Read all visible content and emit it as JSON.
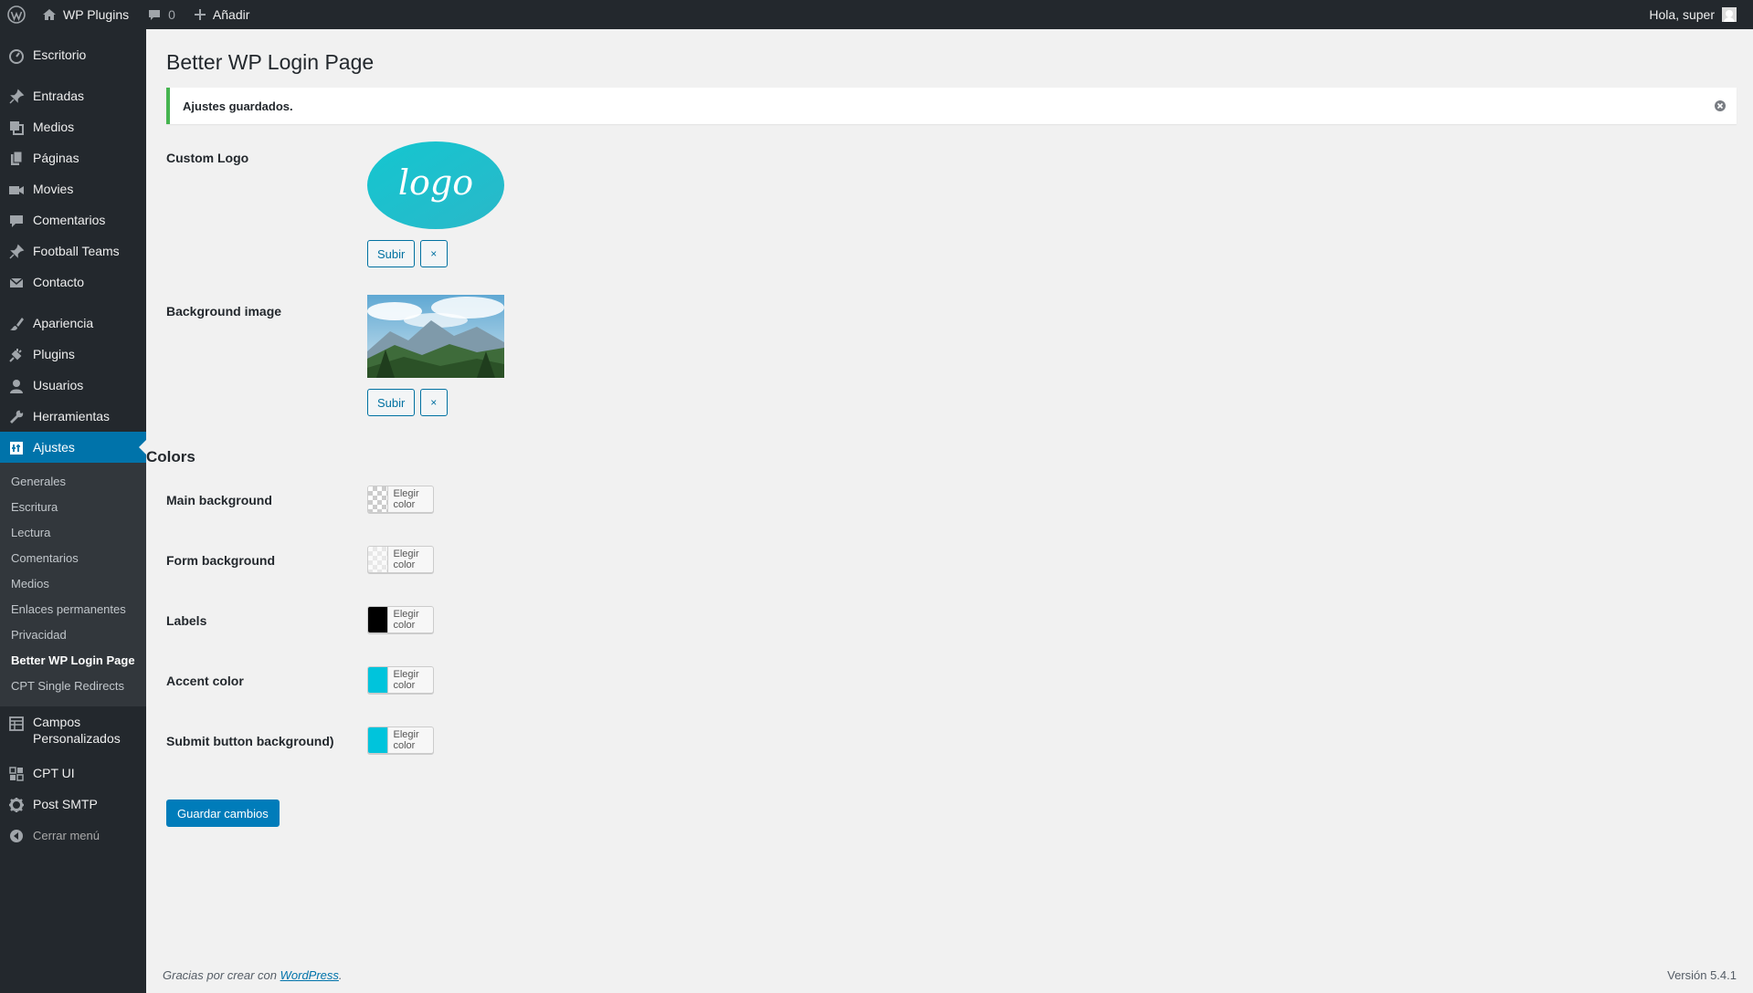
{
  "adminbar": {
    "site_name": "WP Plugins",
    "comments_count": "0",
    "add_new_label": "Añadir",
    "greeting": "Hola, super"
  },
  "sidebar": {
    "dashboard": "Escritorio",
    "items_a": [
      "Entradas",
      "Medios",
      "Páginas",
      "Movies",
      "Comentarios",
      "Football Teams",
      "Contacto"
    ],
    "items_b": [
      "Apariencia",
      "Plugins",
      "Usuarios",
      "Herramientas"
    ],
    "current": "Ajustes",
    "submenu": [
      "Generales",
      "Escritura",
      "Lectura",
      "Comentarios",
      "Medios",
      "Enlaces permanentes",
      "Privacidad"
    ],
    "submenu_current": "Better WP Login Page",
    "submenu_last": "CPT Single Redirects",
    "custom_fields": "Campos Personalizados",
    "cpt_ui": "CPT UI",
    "post_smtp": "Post SMTP",
    "collapse": "Cerrar menú"
  },
  "page": {
    "title": "Better WP Login Page",
    "notice": "Ajustes guardados.",
    "custom_logo_label": "Custom Logo",
    "logo_text": "logo",
    "bg_image_label": "Background image",
    "upload_label": "Subir",
    "remove_label": "×",
    "colors_heading": "Colors",
    "choose_color_label": "Elegir color",
    "colors": [
      {
        "label": "Main background",
        "value": "transparent"
      },
      {
        "label": "Form background",
        "value": "transparent-faint"
      },
      {
        "label": "Labels",
        "value": "#000000"
      },
      {
        "label": "Accent color",
        "value": "#00c4dc"
      },
      {
        "label": "Submit button background)",
        "value": "#00c4dc"
      }
    ],
    "save_label": "Guardar cambios"
  },
  "footer": {
    "thanks_prefix": "Gracias por crear con ",
    "thanks_link": "WordPress",
    "thanks_suffix": ".",
    "version": "Versión 5.4.1"
  },
  "theme": {
    "admin_dark": "#23282d",
    "accent_blue": "#0073aa",
    "success_green": "#46b450",
    "logo_teal": "#1ec3cf"
  }
}
